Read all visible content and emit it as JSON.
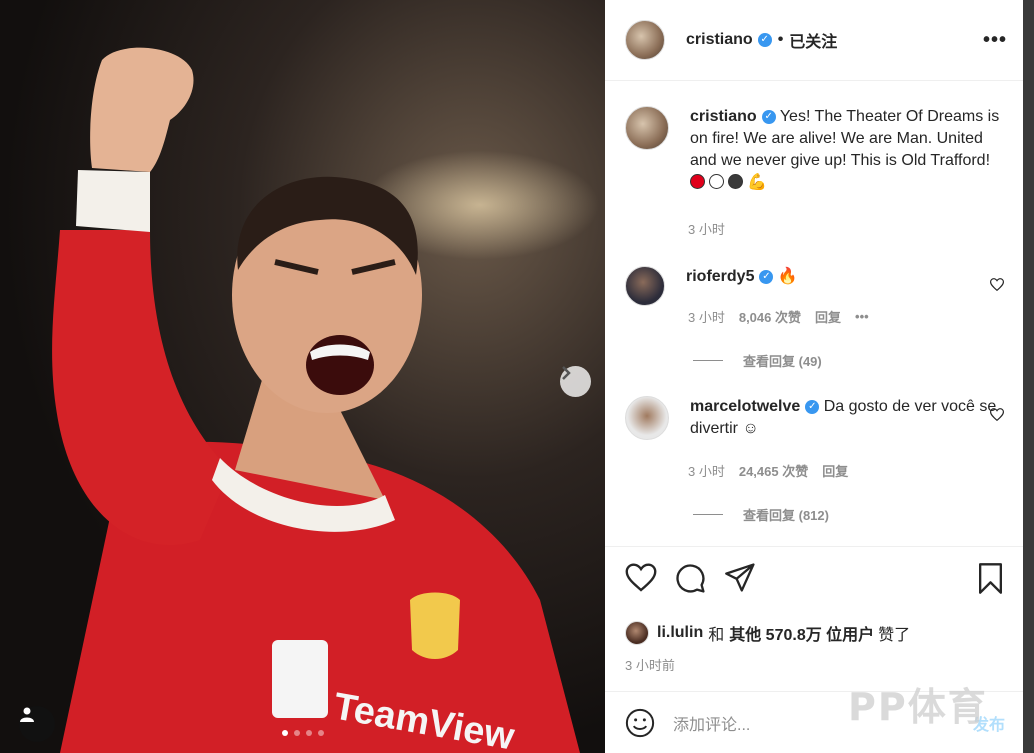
{
  "post": {
    "username": "cristiano",
    "separator": "•",
    "follow_status": "已关注",
    "more": "•••"
  },
  "caption": {
    "username": "cristiano",
    "text": "Yes! The Theater Of Dreams is on fire! We are alive! We are Man. United and we never give up! This is Old Trafford!",
    "emoji_colors": [
      "#e0001b",
      "#ffffff",
      "#3a3a3a"
    ],
    "time": "3 小时"
  },
  "comments": [
    {
      "username": "rioferdy5",
      "text": "🔥",
      "time": "3 小时",
      "likes": "8,046 次赞",
      "reply": "回复",
      "more": "•••",
      "view_replies": "查看回复 (49)"
    },
    {
      "username": "marcelotwelve",
      "text": "Da gosto de ver você se divertir ☺",
      "time": "3 小时",
      "likes": "24,465 次赞",
      "reply": "回复",
      "view_replies": "查看回复 (812)"
    }
  ],
  "likes": {
    "user": "li.lulin",
    "and": "和",
    "others": "其他 570.8万 位用户",
    "suffix": "赞了"
  },
  "post_time": "3 小时前",
  "add_comment": {
    "placeholder": "添加评论...",
    "post_label": "发布"
  },
  "watermark": "PP体育",
  "icons": [
    "heart-icon",
    "comment-icon",
    "share-icon",
    "bookmark-icon",
    "emoji-icon",
    "chevron-right-icon",
    "user-icon"
  ],
  "carousel": {
    "count": 4,
    "active": 1
  }
}
